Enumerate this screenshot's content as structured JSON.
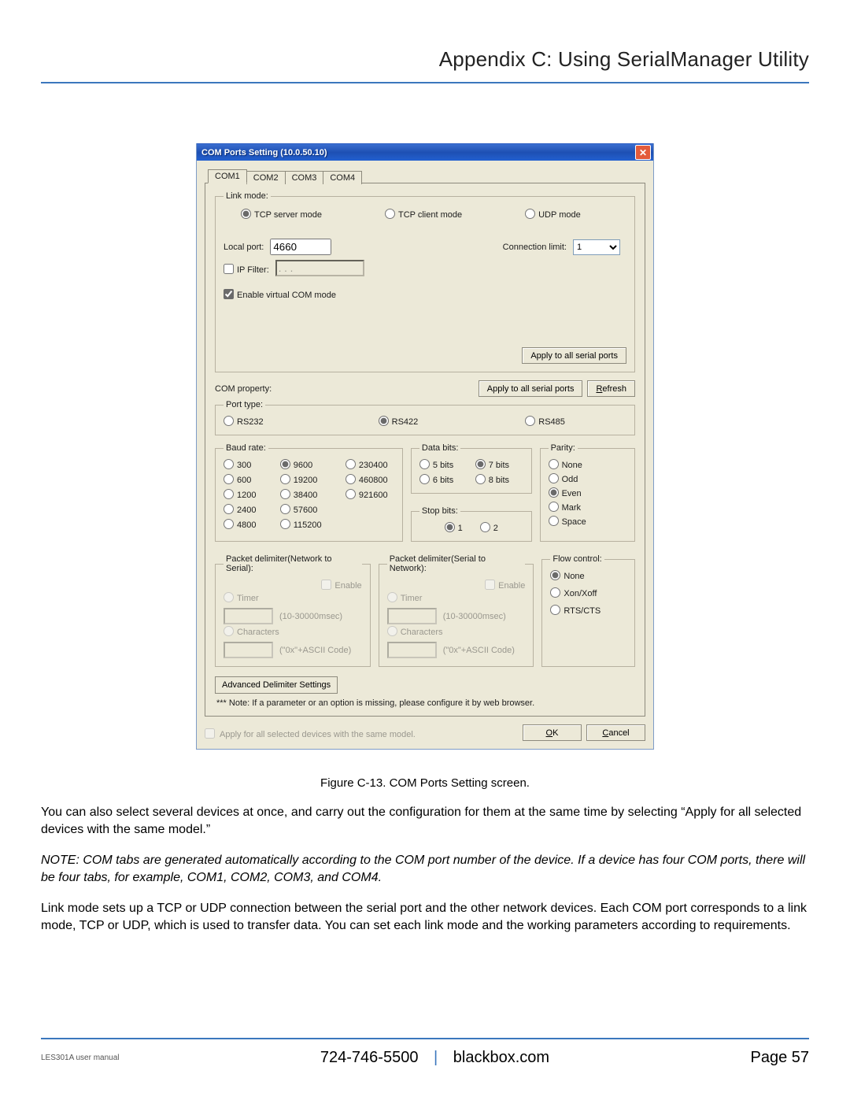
{
  "page": {
    "appendix_title": "Appendix C: Using SerialManager Utility",
    "figure_caption": "Figure C-13. COM Ports Setting screen.",
    "para1": "You can also select several devices at once, and carry out the configuration for them at the same time by selecting “Apply for all selected devices with the same model.”",
    "para2_prefix": "NOTE: COM tabs are generated automatically according to the COM port number of the device. If a device has four COM ports, there will be four tabs, for example, COM1, COM2, COM3, and COM4.",
    "para3": "Link mode sets up a TCP or UDP connection between the serial port and the other network devices. Each COM port corresponds to a link mode, TCP or UDP, which is used to transfer data. You can set each link mode and the working parameters according to requirements.",
    "footer_left": "LES301A user manual",
    "footer_phone": "724-746-5500",
    "footer_site": "blackbox.com",
    "footer_page": "Page 57"
  },
  "dialog": {
    "title": "COM Ports Setting (10.0.50.10)",
    "tabs": [
      "COM1",
      "COM2",
      "COM3",
      "COM4"
    ],
    "active_tab": 0,
    "link_mode": {
      "legend": "Link mode:",
      "options": {
        "tcp_server": "TCP server mode",
        "tcp_client": "TCP client mode",
        "udp": "UDP mode"
      },
      "selected": "tcp_server",
      "local_port_label": "Local port:",
      "local_port_value": "4660",
      "conn_limit_label": "Connection limit:",
      "conn_limit_value": "1",
      "ip_filter_label": "IP Filter:",
      "ip_filter_checked": false,
      "ip_filter_value": ". . .",
      "enable_vcom_label": "Enable virtual COM mode",
      "enable_vcom_checked": true,
      "apply_all_btn": "Apply to all serial ports"
    },
    "com_property_label": "COM property:",
    "apply_all_btn2": "Apply to all serial ports",
    "refresh_btn": "Refresh",
    "port_type": {
      "legend": "Port type:",
      "options": [
        "RS232",
        "RS422",
        "RS485"
      ],
      "selected": "RS422"
    },
    "baud": {
      "legend": "Baud rate:",
      "options": [
        "300",
        "600",
        "1200",
        "2400",
        "4800",
        "9600",
        "19200",
        "38400",
        "57600",
        "115200",
        "230400",
        "460800",
        "921600"
      ],
      "selected": "9600"
    },
    "data_bits": {
      "legend": "Data bits:",
      "options": [
        "5 bits",
        "6 bits",
        "7 bits",
        "8 bits"
      ],
      "selected": "7 bits"
    },
    "stop_bits": {
      "legend": "Stop bits:",
      "options": [
        "1",
        "2"
      ],
      "selected": "1"
    },
    "parity": {
      "legend": "Parity:",
      "options": [
        "None",
        "Odd",
        "Even",
        "Mark",
        "Space"
      ],
      "selected": "Even"
    },
    "delim_n2s": {
      "legend": "Packet delimiter(Network to Serial):",
      "enable": "Enable",
      "timer": "Timer",
      "timer_hint": "(10-30000msec)",
      "chars": "Characters",
      "chars_hint": "(\"0x\"+ASCII Code)"
    },
    "delim_s2n": {
      "legend": "Packet delimiter(Serial to Network):",
      "enable": "Enable",
      "timer": "Timer",
      "timer_hint": "(10-30000msec)",
      "chars": "Characters",
      "chars_hint": "(\"0x\"+ASCII Code)"
    },
    "flow": {
      "legend": "Flow control:",
      "options": [
        "None",
        "Xon/Xoff",
        "RTS/CTS"
      ],
      "selected": "None"
    },
    "adv_btn": "Advanced Delimiter Settings",
    "note": "*** Note: If a parameter or an option is missing, please configure it by web browser.",
    "apply_all_devices_label": "Apply for all selected devices with the same model.",
    "apply_all_devices_checked": false,
    "ok": "OK",
    "cancel": "Cancel"
  }
}
